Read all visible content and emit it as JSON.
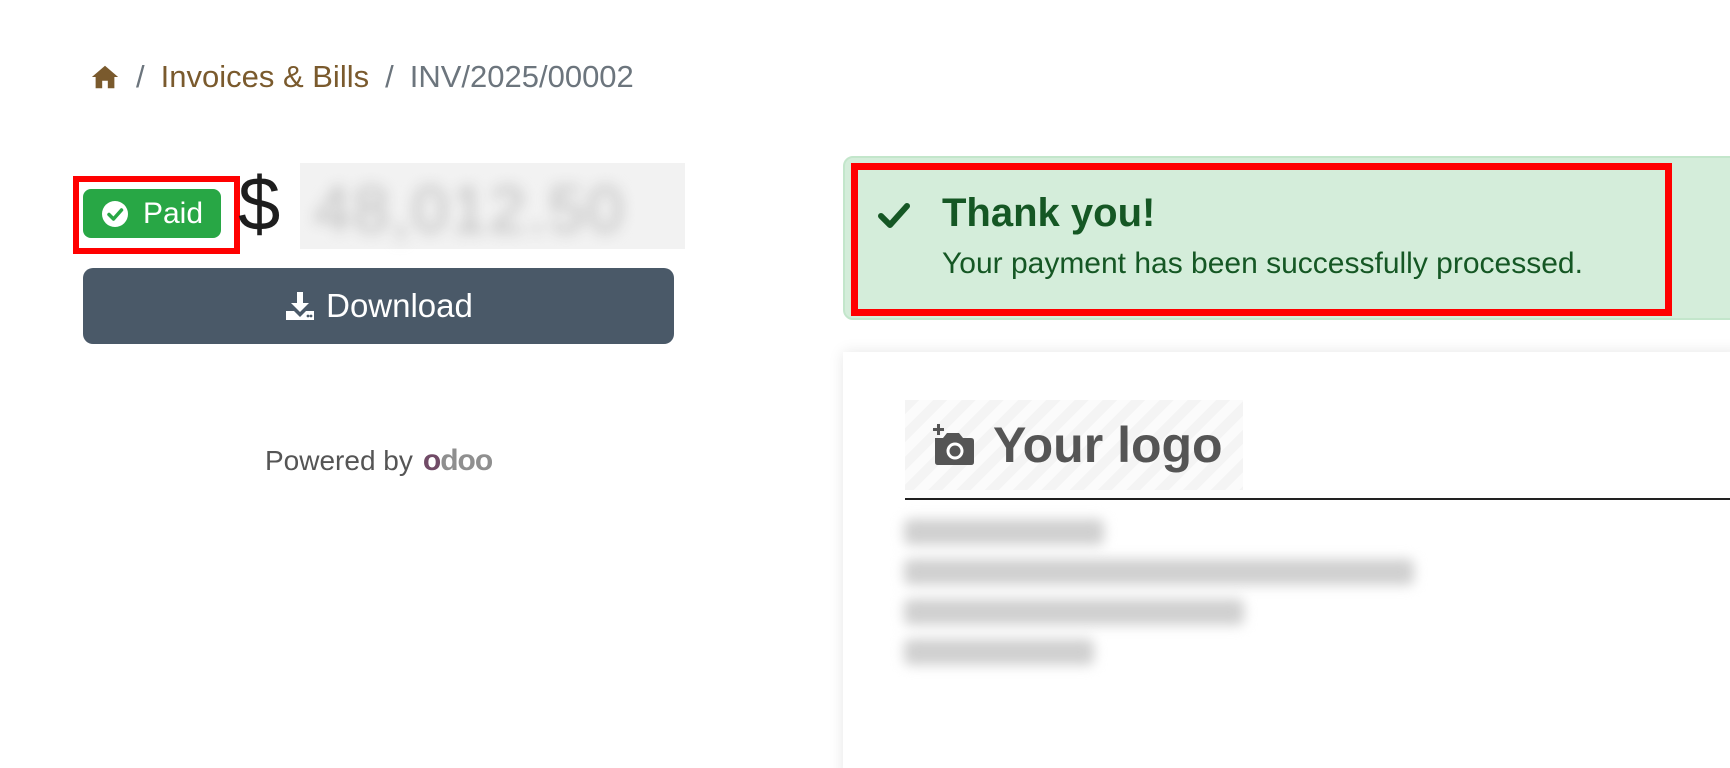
{
  "breadcrumb": {
    "home_icon": "home-icon",
    "separator": "/",
    "link_label": "Invoices & Bills",
    "current": "INV/2025/00002"
  },
  "invoice": {
    "status": "Paid",
    "status_icon": "check-circle-icon",
    "currency": "$",
    "amount": "48,012.50",
    "download_label": "Download",
    "download_icon": "download-icon"
  },
  "powered": {
    "label": "Powered by",
    "brand": "odoo"
  },
  "alert": {
    "icon": "check-icon",
    "title": "Thank you!",
    "message": "Your payment has been successfully processed."
  },
  "document": {
    "logo_icon": "camera-plus-icon",
    "logo_text": "Your logo"
  },
  "colors": {
    "brand_link": "#7a5a2d",
    "paid": "#28a745",
    "button": "#4a5968",
    "alert_bg": "#d4edda",
    "alert_text": "#155724",
    "highlight": "#ff0000"
  }
}
